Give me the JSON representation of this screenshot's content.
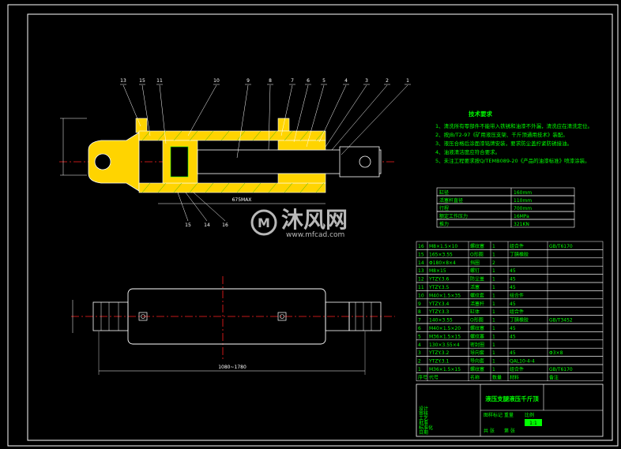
{
  "drawing": {
    "title": "液压支腿液压千斤顶",
    "scale": "1:1"
  },
  "balloons": [
    "13",
    "15",
    "11",
    "10",
    "9",
    "8",
    "7",
    "6",
    "5",
    "4",
    "3",
    "2",
    "1"
  ],
  "balloons_bottom": [
    "15",
    "14",
    "16"
  ],
  "dimensions": {
    "overall_top": "675MAX",
    "overall_bottom": "1080~1780"
  },
  "tech_req": {
    "title": "技术要求",
    "items": [
      "1、清洗所有零部件不能带入铁锈和油漆不外漏，清洗应在清洗定位。",
      "2、按JB/T2-97《矿用液压支架、千斤顶通用技术》装配。",
      "3、液压合格后涂面漆铭牌安装，要求防尘盖拧紧防锈接油。",
      "4、油液清洁度应符合要求。",
      "5、未注工程要求按Q/TEMB089-20《产品的油漆标准》喷漆涂装。"
    ]
  },
  "params": [
    {
      "k": "缸径",
      "v": "160mm"
    },
    {
      "k": "活塞杆直径",
      "v": "110mm"
    },
    {
      "k": "行程",
      "v": "700mm"
    },
    {
      "k": "额定工作压力",
      "v": "16MPa"
    },
    {
      "k": "推力",
      "v": "321KN"
    }
  ],
  "bom": [
    {
      "no": "16",
      "code": "M8×1.5×10",
      "name": "螺纹塞",
      "qty": "1",
      "mat": "组合件",
      "note": "GB/T6170"
    },
    {
      "no": "15",
      "code": "165×3.55",
      "name": "O形圈",
      "qty": "1",
      "mat": "丁腈橡胶",
      "note": ""
    },
    {
      "no": "14",
      "code": "Φ180×8×4",
      "name": "挡圈",
      "qty": "2",
      "mat": "",
      "note": ""
    },
    {
      "no": "13",
      "code": "M8×15",
      "name": "螺钉",
      "qty": "1",
      "mat": "45",
      "note": ""
    },
    {
      "no": "12",
      "code": "YTZY.3.6",
      "name": "防尘盖",
      "qty": "1",
      "mat": "45",
      "note": ""
    },
    {
      "no": "11",
      "code": "YTZY.3.5",
      "name": "活塞",
      "qty": "1",
      "mat": "45",
      "note": ""
    },
    {
      "no": "10",
      "code": "M40×1.5×35",
      "name": "螺纹套",
      "qty": "1",
      "mat": "组合件",
      "note": ""
    },
    {
      "no": "9",
      "code": "YTZY.3.4",
      "name": "活塞杆",
      "qty": "1",
      "mat": "45",
      "note": ""
    },
    {
      "no": "8",
      "code": "YTZY.3.3",
      "name": "缸体",
      "qty": "1",
      "mat": "组合件",
      "note": ""
    },
    {
      "no": "7",
      "code": "140×3.55",
      "name": "O形圈",
      "qty": "1",
      "mat": "丁腈橡胶",
      "note": "GB/T3452"
    },
    {
      "no": "6",
      "code": "M40×1.5×20",
      "name": "螺纹塞",
      "qty": "1",
      "mat": "45",
      "note": ""
    },
    {
      "no": "5",
      "code": "M36×1.5×15",
      "name": "螺纹塞",
      "qty": "1",
      "mat": "45",
      "note": ""
    },
    {
      "no": "4",
      "code": "130×3.55×4",
      "name": "密封圈",
      "qty": "1",
      "mat": "",
      "note": ""
    },
    {
      "no": "3",
      "code": "YTZY.3.2",
      "name": "导向套",
      "qty": "1",
      "mat": "45",
      "note": "Φ3×8"
    },
    {
      "no": "2",
      "code": "YTZY.3.1",
      "name": "导向套",
      "qty": "1",
      "mat": "QAL10-4-4",
      "note": ""
    },
    {
      "no": "1",
      "code": "M36×1.5×15",
      "name": "螺纹塞",
      "qty": "1",
      "mat": "组合件",
      "note": "GB/T6170"
    }
  ],
  "bom_header": {
    "no": "序号",
    "code": "代号",
    "name": "名称",
    "qty": "数量",
    "mat": "材料",
    "note": "备注"
  },
  "title_block": {
    "labels": [
      "设计",
      "审核",
      "工艺",
      "批准",
      "标准化",
      "日期"
    ],
    "cells": [
      "图样标记",
      "重量",
      "比例",
      "共 张",
      "第 张"
    ]
  },
  "watermark": {
    "brand": "沐风网",
    "url": "www.mfcad.com"
  },
  "colors": {
    "line": "#00ff00",
    "hatch": "#ffd400",
    "center": "#ff2020",
    "dim": "#ffffff",
    "outline": "#ffffff"
  }
}
